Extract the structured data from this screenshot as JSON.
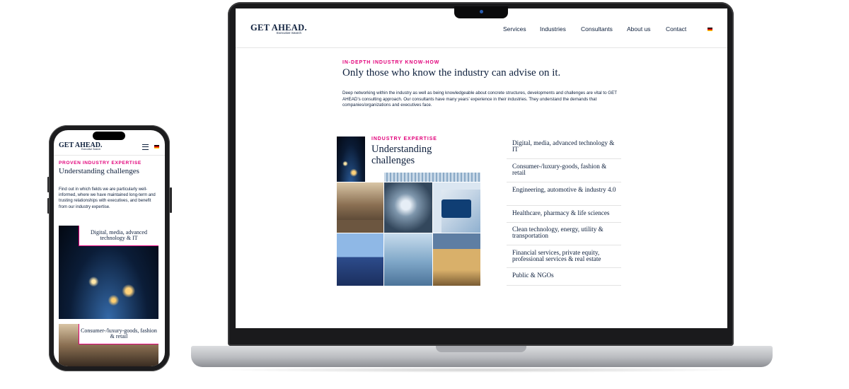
{
  "brand": {
    "name": "GET AHEAD.",
    "tagline": "Executive Search"
  },
  "nav": {
    "items": [
      "Services",
      "Industries",
      "Consultants",
      "About us",
      "Contact"
    ],
    "language": "de"
  },
  "intro": {
    "eyebrow": "IN-DEPTH INDUSTRY KNOW-HOW",
    "heading": "Only those who know the industry can advise on it.",
    "body": "Deep networking within the industry as well as being knowledgeable about concrete structures, developments and challenges are vital to GET AHEAD’s consulting approach. Our consultants have many years’ experience in their industries. They understand the demands that companies/organizations and executives face."
  },
  "expertise": {
    "eyebrow": "INDUSTRY EXPERTISE",
    "heading": "Understanding challenges"
  },
  "industries": [
    "Digital, media, advanced technology & IT",
    "Consumer-/luxury-goods, fashion & retail",
    "Engineering, automotive & industry 4.0",
    "Healthcare, pharmacy & life sciences",
    "Clean technology, energy, utility & transportation",
    "Financial services, private equity, professional services & real estate",
    "Public & NGOs"
  ],
  "mobile": {
    "eyebrow": "PROVEN INDUSTRY EXPERTISE",
    "heading": "Understanding challenges",
    "body": "Find out in which fields we are particularly well-informed, where we have maintained long-term and trusting relationships with executives, and benefit from our industry expertise.",
    "cards": [
      "Digital, media, advanced technology & IT",
      "Consumer-/luxury-goods, fashion & retail"
    ]
  },
  "colors": {
    "accent": "#e2007a",
    "navy": "#0d1f3c"
  }
}
